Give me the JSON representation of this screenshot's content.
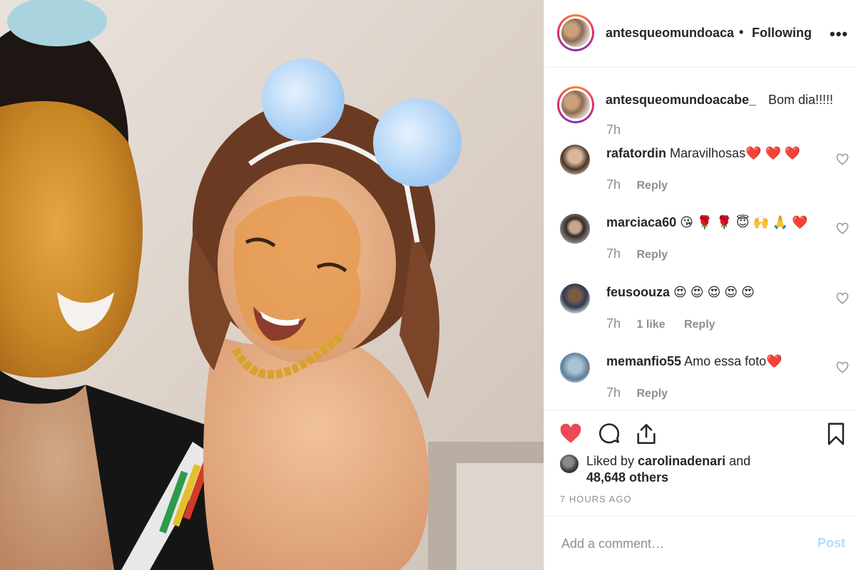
{
  "post": {
    "author": "antesqueomundoaca",
    "separator": "•",
    "follow_status": "Following",
    "more": "•••"
  },
  "caption": {
    "user": "antesqueomundoacabe_",
    "text": "Bom dia!!!!!",
    "time": "7h"
  },
  "comments": [
    {
      "user": "rafatordin",
      "text": "Maravilhosas❤️ ❤️ ❤️",
      "time": "7h",
      "likes": "",
      "reply": "Reply"
    },
    {
      "user": "marciaca60",
      "text": "😘 🌹 🌹 😇 🙌 🙏 ❤️",
      "time": "7h",
      "likes": "",
      "reply": "Reply"
    },
    {
      "user": "feusoouza",
      "text": "😍 😍 😍 😍 😍",
      "time": "7h",
      "likes": "1 like",
      "reply": "Reply"
    },
    {
      "user": "memanfio55",
      "text": "Amo essa foto❤️",
      "time": "7h",
      "likes": "",
      "reply": "Reply"
    }
  ],
  "likes": {
    "prefix": "Liked by ",
    "user": "carolinadenari",
    "conj": " and",
    "others": "48,648 others"
  },
  "timestamp": "7 HOURS AGO",
  "add_comment": {
    "placeholder": "Add a comment…",
    "post_label": "Post"
  },
  "colors": {
    "like_red": "#ed4956",
    "post_disabled": "#b3dbff",
    "secondary_text": "#8e8e8e"
  }
}
